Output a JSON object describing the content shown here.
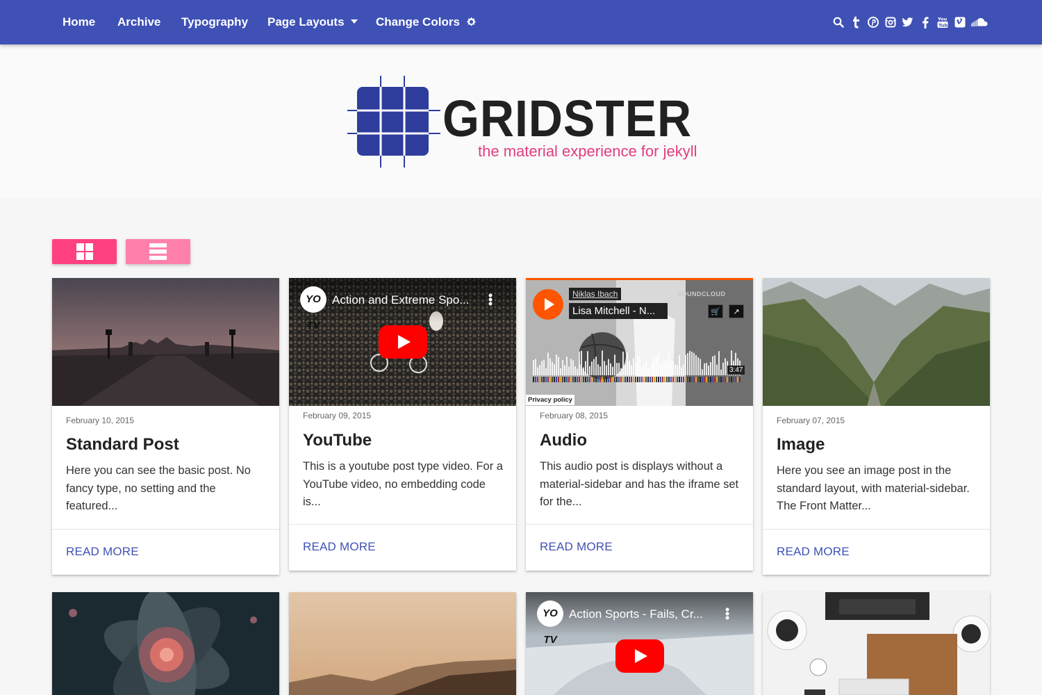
{
  "nav": {
    "items": [
      {
        "label": "Home"
      },
      {
        "label": "Archive"
      },
      {
        "label": "Typography"
      },
      {
        "label": "Page Layouts"
      },
      {
        "label": "Change Colors"
      }
    ],
    "social_icons": [
      "search-icon",
      "tumblr-icon",
      "pinterest-icon",
      "instagram-icon",
      "twitter-icon",
      "facebook-icon",
      "youtube-icon",
      "vimeo-icon",
      "soundcloud-icon"
    ]
  },
  "header": {
    "brand": "GRIDSTER",
    "tagline": "the material experience for jekyll"
  },
  "view_toggles": [
    "grid-view",
    "list-view"
  ],
  "colors": {
    "primary": "#3f51b5",
    "accent": "#ff4081",
    "accent_light": "#ff80ab",
    "tagline": "#e23d7f"
  },
  "cards": [
    {
      "date": "February 10, 2015",
      "title": "Standard Post",
      "excerpt": "Here you can see the basic post. No fancy type, no setting and the featured...",
      "more": "READ MORE"
    },
    {
      "date": "February 09, 2015",
      "title": "YouTube",
      "excerpt": "This is a youtube post type video. For a YouTube video, no embedding code is...",
      "more": "READ MORE",
      "video": {
        "channel": "YO TV",
        "title": "Action and Extreme Spo..."
      }
    },
    {
      "date": "February 08, 2015",
      "title": "Audio",
      "excerpt": "This audio post is displays without a material-sidebar and has the iframe set for the...",
      "more": "READ MORE",
      "audio": {
        "artist": "Niklas Ibach",
        "track": "Lisa Mitchell - N...",
        "brand": "SOUNDCLOUD",
        "duration": "3:47",
        "privacy": "Privacy policy"
      }
    },
    {
      "date": "February 07, 2015",
      "title": "Image",
      "excerpt": "Here you see an image post in the standard layout, with material-sidebar. The Front Matter...",
      "more": "READ MORE"
    }
  ],
  "row2": {
    "video": {
      "channel": "YO TV",
      "title": "Action Sports - Fails, Cr..."
    }
  }
}
